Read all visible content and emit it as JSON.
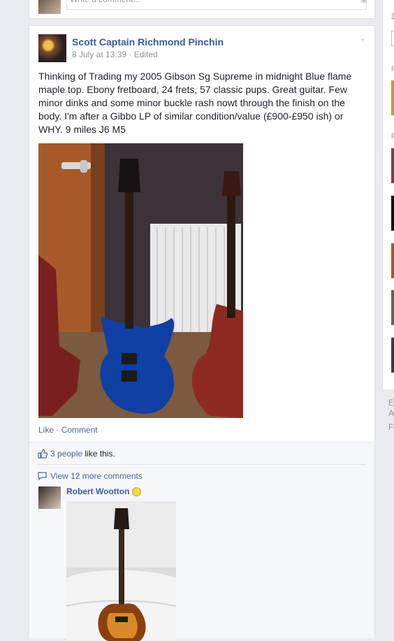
{
  "top_comment": {
    "placeholder": "Write a comment...",
    "camera_icon": "camera-icon"
  },
  "post": {
    "author": "Scott Captain Richmond Pinchin",
    "date": "8 July at 13:39",
    "edited": "Edited",
    "meta_sep": " · ",
    "text": "Thinking of Trading my 2005 Gibson Sg Supreme in midnight Blue flame maple top. Ebony fretboard, 24 frets, 57 classic pups. Great guitar. Few minor dinks and some minor buckle rash nowt through the finish on the body. I'm after a Gibbo LP of similar condition/value (£900-£950 ish) or WHY. 9 miles J6 M5",
    "actions": {
      "like": "Like",
      "sep": " · ",
      "comment": "Comment"
    },
    "likes": {
      "link": "3 people",
      "suffix": " like this."
    },
    "view_more": "View 12 more comments",
    "comment": {
      "author": "Robert Wootton"
    }
  },
  "right_column": {
    "link1": "3",
    "head1": "P",
    "head2": "P"
  },
  "footer": {
    "line1": "E",
    "line2": "A",
    "line3": "Fa"
  },
  "colors": {
    "link": "#3b5998",
    "background": "#e9ebee",
    "muted": "#90949c"
  }
}
